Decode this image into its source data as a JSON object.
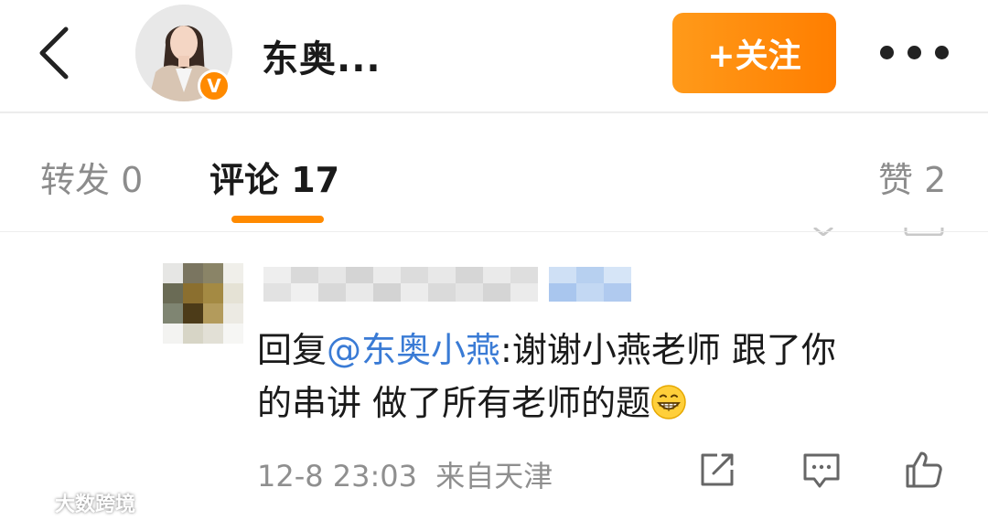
{
  "header": {
    "author_name": "东奥...",
    "follow_label": "+关注",
    "verified_badge": "V",
    "icons": {
      "back": "chevron-left-icon",
      "more": "more-dots-icon"
    }
  },
  "tabs": [
    {
      "label": "转发 0",
      "active": false
    },
    {
      "label": "评论 17",
      "active": true
    },
    {
      "label": "赞 2",
      "active": false
    }
  ],
  "comment": {
    "reply_prefix": "回复",
    "mention": "@东奥小燕",
    "text_line1": ":谢谢小燕老师  跟了你",
    "text_line2": "的串讲 做了所有老师的题",
    "emoji": "grin-emoji",
    "timestamp": "12-8 23:03",
    "source": "来自天津",
    "actions": [
      "share-icon",
      "comment-icon",
      "like-icon"
    ]
  },
  "watermark": "大数跨境",
  "colors": {
    "accent": "#ff8a00",
    "mention": "#3a7bd5",
    "muted_text": "#8f8f8f"
  }
}
